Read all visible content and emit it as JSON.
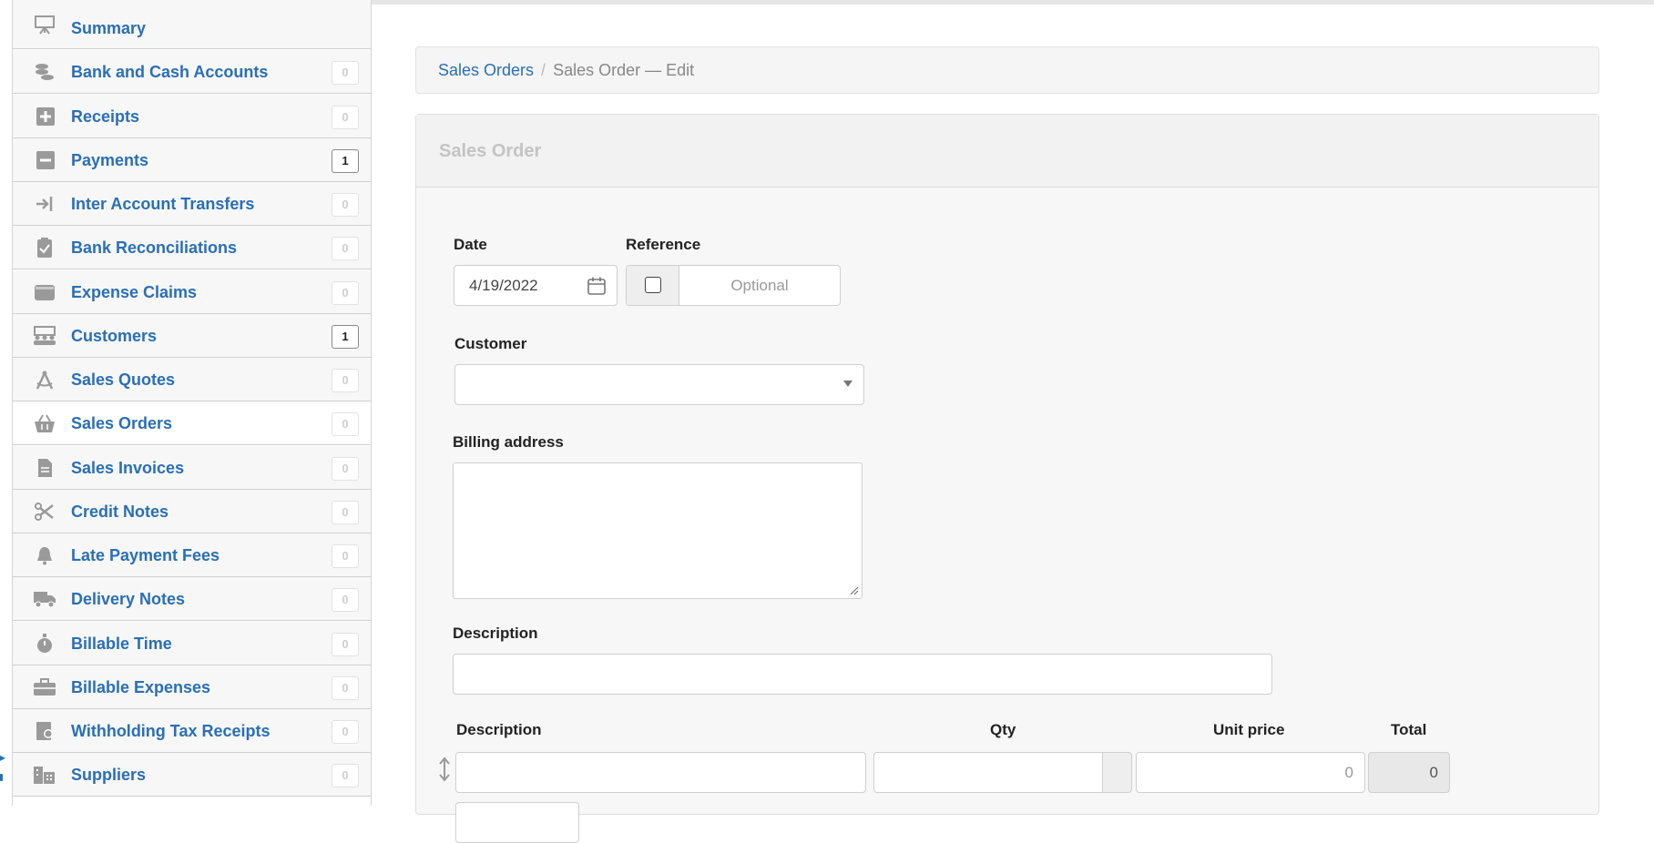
{
  "sidebar": {
    "items": [
      {
        "label": "Summary",
        "icon": "presentation-board-icon",
        "badge": "",
        "active": false
      },
      {
        "label": "Bank and Cash Accounts",
        "icon": "coins-stack-icon",
        "badge": "0",
        "active": false
      },
      {
        "label": "Receipts",
        "icon": "plus-square-icon",
        "badge": "0",
        "active": false
      },
      {
        "label": "Payments",
        "icon": "minus-square-icon",
        "badge": "1",
        "active": false
      },
      {
        "label": "Inter Account Transfers",
        "icon": "arrow-to-line-icon",
        "badge": "0",
        "active": false
      },
      {
        "label": "Bank Reconciliations",
        "icon": "clipboard-check-icon",
        "badge": "0",
        "active": false
      },
      {
        "label": "Expense Claims",
        "icon": "wallet-icon",
        "badge": "0",
        "active": false
      },
      {
        "label": "Customers",
        "icon": "people-group-icon",
        "badge": "1",
        "active": false
      },
      {
        "label": "Sales Quotes",
        "icon": "compass-drafting-icon",
        "badge": "0",
        "active": false
      },
      {
        "label": "Sales Orders",
        "icon": "basket-icon",
        "badge": "0",
        "active": true
      },
      {
        "label": "Sales Invoices",
        "icon": "document-icon",
        "badge": "0",
        "active": false
      },
      {
        "label": "Credit Notes",
        "icon": "scissors-icon",
        "badge": "0",
        "active": false
      },
      {
        "label": "Late Payment Fees",
        "icon": "bell-icon",
        "badge": "0",
        "active": false
      },
      {
        "label": "Delivery Notes",
        "icon": "truck-icon",
        "badge": "0",
        "active": false
      },
      {
        "label": "Billable Time",
        "icon": "stopwatch-icon",
        "badge": "0",
        "active": false
      },
      {
        "label": "Billable Expenses",
        "icon": "briefcase-icon",
        "badge": "0",
        "active": false
      },
      {
        "label": "Withholding Tax Receipts",
        "icon": "certificate-icon",
        "badge": "0",
        "active": false
      },
      {
        "label": "Suppliers",
        "icon": "buildings-icon",
        "badge": "0",
        "active": false
      }
    ]
  },
  "breadcrumb": {
    "link": "Sales Orders",
    "separator": "/",
    "current": "Sales Order — Edit"
  },
  "panel": {
    "title": "Sales Order"
  },
  "form": {
    "date_label": "Date",
    "date_value": "4/19/2022",
    "reference_label": "Reference",
    "reference_placeholder": "Optional",
    "customer_label": "Customer",
    "customer_value": "",
    "billing_label": "Billing address",
    "billing_value": "",
    "description_label": "Description",
    "description_value": ""
  },
  "lines": {
    "headers": {
      "description": "Description",
      "qty": "Qty",
      "unit_price": "Unit price",
      "total": "Total"
    },
    "rows": [
      {
        "description": "",
        "qty": "",
        "unit_price": "0",
        "total": "0"
      }
    ]
  },
  "colors": {
    "link": "#2a6fb4",
    "icon_gray": "#9a9a9a"
  }
}
